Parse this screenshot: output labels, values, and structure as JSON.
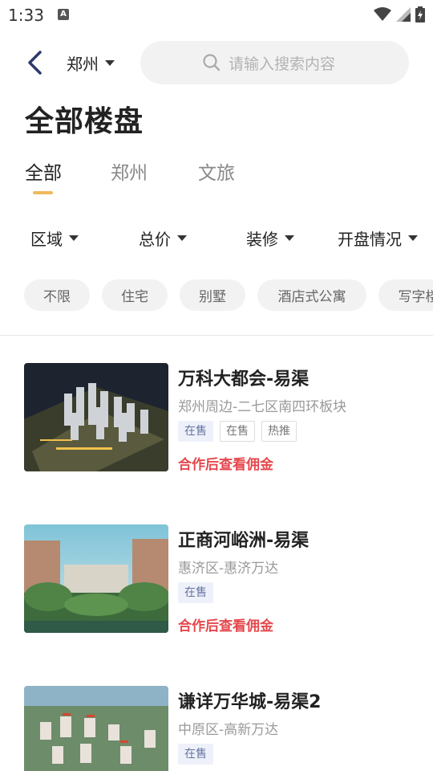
{
  "status": {
    "time": "1:33",
    "notification_icon": "A"
  },
  "header": {
    "city": "郑州",
    "search_placeholder": "请输入搜索内容"
  },
  "title": "全部楼盘",
  "tabs": [
    {
      "label": "全部",
      "active": true
    },
    {
      "label": "郑州",
      "active": false
    },
    {
      "label": "文旅",
      "active": false
    }
  ],
  "filters": [
    "区域",
    "总价",
    "装修",
    "开盘情况"
  ],
  "chips": [
    "不限",
    "住宅",
    "别墅",
    "酒店式公寓",
    "写字楼"
  ],
  "listings": [
    {
      "name": "万科大都会-易渠",
      "location": "郑州周边-二七区南四环板块",
      "tags": [
        "在售",
        "在售",
        "热推"
      ],
      "commission": "合作后查看佣金"
    },
    {
      "name": "正商河峪洲-易渠",
      "location": "惠济区-惠济万达",
      "tags": [
        "在售"
      ],
      "commission": "合作后查看佣金"
    },
    {
      "name": "谦详万华城-易渠2",
      "location": "中原区-高新万达",
      "tags": [
        "在售"
      ],
      "commission": ""
    }
  ],
  "colors": {
    "accent_underline": "#f0b85c",
    "commission_red": "#e5484d",
    "tag_sale_bg": "#eef1fa",
    "search_bg": "#f2f2f2"
  }
}
